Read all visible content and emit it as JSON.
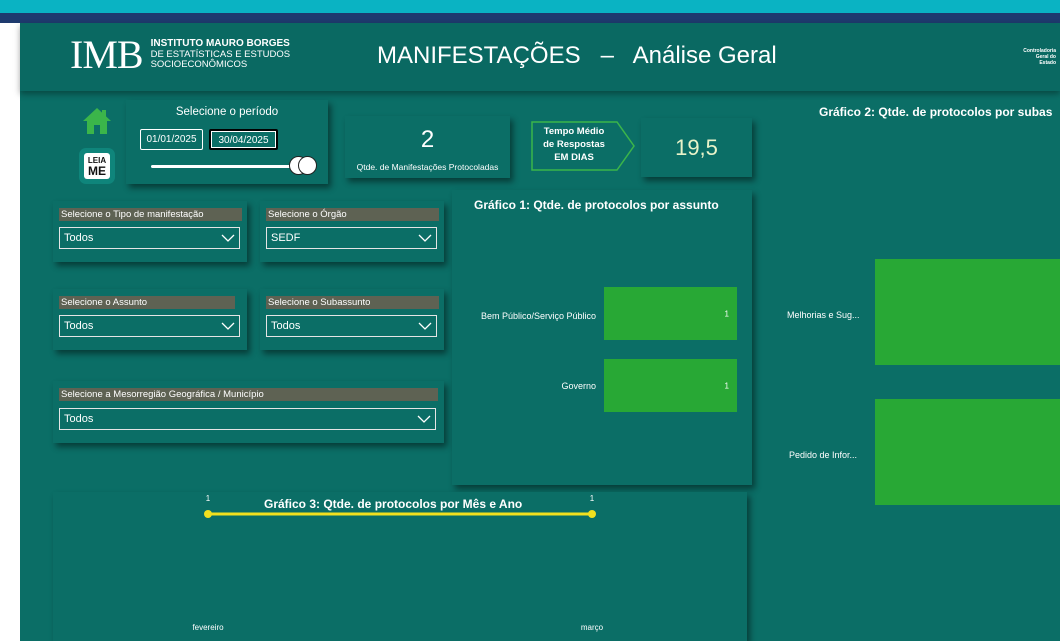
{
  "header": {
    "logo_mark": "IMB",
    "logo_line1": "INSTITUTO MAURO BORGES",
    "logo_line2": "DE ESTATÍSTICAS E ESTUDOS",
    "logo_line3": "SOCIOECONÔMICOS",
    "title": "MANIFESTAÇÕES   –   Análise Geral",
    "cge_line1": "Controladoria",
    "cge_line2": "Geral do",
    "cge_line3": "Estado"
  },
  "nav": {
    "home_icon": "home-icon",
    "leia_line1": "LEIA",
    "leia_line2": "ME"
  },
  "period": {
    "title": "Selecione o período",
    "start": "01/01/2025",
    "end": "30/04/2025"
  },
  "kpis": {
    "count_value": "2",
    "count_caption": "Qtde. de Manifestações Protocoladas",
    "avg_label_line1": "Tempo Médio",
    "avg_label_line2": "de Respostas",
    "avg_label_line3": "EM DIAS",
    "avg_value": "19,5"
  },
  "filters": {
    "tipo": {
      "label": "Selecione o Tipo de manifestação",
      "value": "Todos"
    },
    "orgao": {
      "label": "Selecione o Órgão",
      "value": "SEDF"
    },
    "assunto": {
      "label": "Selecione o Assunto",
      "value": "Todos"
    },
    "subassunto": {
      "label": "Selecione o Subassunto",
      "value": "Todos"
    },
    "mesorregiao": {
      "label": "Selecione a Mesorregião Geográfica / Município",
      "value": "Todos"
    }
  },
  "colors": {
    "bar": "#28a835",
    "line": "#f2e01e",
    "background": "#0b6e66"
  },
  "chart_data": [
    {
      "type": "bar",
      "title": "Gráfico 1: Qtde. de protocolos por assunto",
      "categories": [
        "Bem Público/Serviço Público",
        "Governo"
      ],
      "values": [
        1,
        1
      ]
    },
    {
      "type": "bar",
      "title": "Gráfico 2: Qtde. de protocolos por subas",
      "categories": [
        "Melhorias e Sug...",
        "Pedido de Infor..."
      ],
      "values": [
        1,
        1
      ]
    },
    {
      "type": "line",
      "title": "Gráfico 3: Qtde. de protocolos por Mês e Ano",
      "categories": [
        "fevereiro",
        "março"
      ],
      "values": [
        1,
        1
      ]
    }
  ]
}
